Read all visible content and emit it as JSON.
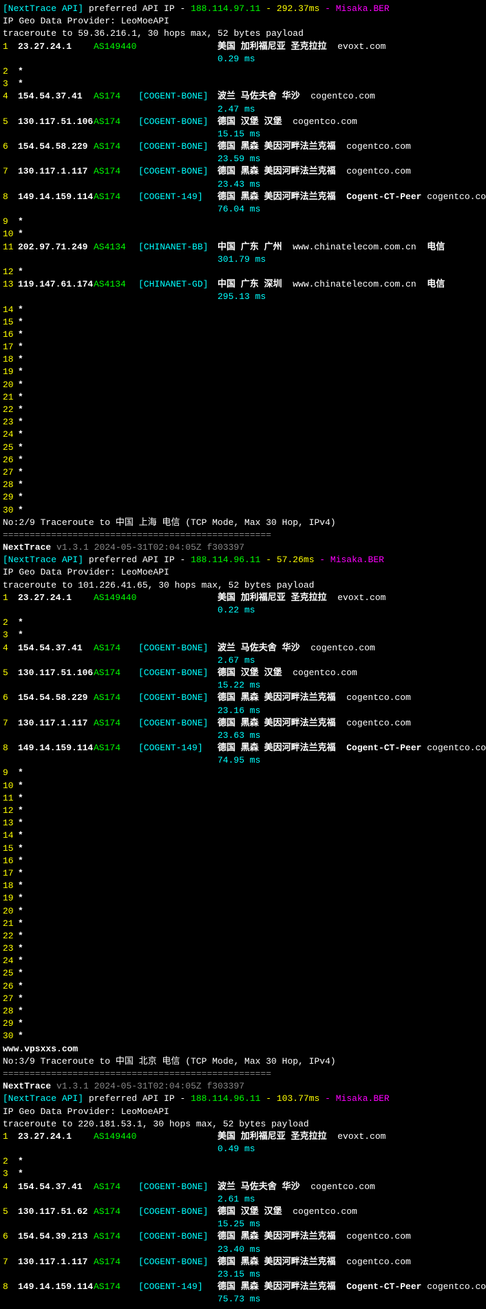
{
  "section1": {
    "api_line_prefix": "[NextTrace API]",
    "api_line_text": " preferred API IP - ",
    "api_ip": "188.114.97.11",
    "api_latency": " - 292.37ms",
    "api_server": " - Misaka.BER",
    "provider": "IP Geo Data Provider: LeoMoeAPI",
    "trace_header": "traceroute to 59.36.216.1, 30 hops max, 52 bytes payload",
    "hops": [
      {
        "n": "1",
        "ip": "23.27.24.1",
        "asn": "AS149440",
        "net": "",
        "geo": "美国 加利福尼亚 圣克拉拉",
        "dom": "evoxt.com",
        "peer": "",
        "lat": "0.29 ms"
      },
      {
        "n": "2",
        "star": true
      },
      {
        "n": "3",
        "star": true
      },
      {
        "n": "4",
        "ip": "154.54.37.41",
        "asn": "AS174",
        "net": "[COGENT-BONE]",
        "geo": "波兰 马佐夫舍 华沙",
        "dom": "cogentco.com",
        "peer": "",
        "lat": "2.47 ms"
      },
      {
        "n": "5",
        "ip": "130.117.51.106",
        "asn": "AS174",
        "net": "[COGENT-BONE]",
        "geo": "德国 汉堡 汉堡",
        "dom": "cogentco.com",
        "peer": "",
        "lat": "15.15 ms"
      },
      {
        "n": "6",
        "ip": "154.54.58.229",
        "asn": "AS174",
        "net": "[COGENT-BONE]",
        "geo": "德国 黑森 美因河畔法兰克福",
        "dom": "cogentco.com",
        "peer": "",
        "lat": "23.59 ms"
      },
      {
        "n": "7",
        "ip": "130.117.1.117",
        "asn": "AS174",
        "net": "[COGENT-BONE]",
        "geo": "德国 黑森 美因河畔法兰克福",
        "dom": "cogentco.com",
        "peer": "",
        "lat": "23.43 ms"
      },
      {
        "n": "8",
        "ip": "149.14.159.114",
        "asn": "AS174",
        "net": "[COGENT-149]",
        "geo": "德国 黑森 美因河畔法兰克福",
        "peer": "Cogent-CT-Peer",
        "dom": "cogentco.com",
        "lat": "76.04 ms"
      },
      {
        "n": "9",
        "star": true
      },
      {
        "n": "10",
        "star": true
      },
      {
        "n": "11",
        "ip": "202.97.71.249",
        "asn": "AS4134",
        "net": "[CHINANET-BB]",
        "geo": "中国 广东 广州",
        "dom": "www.chinatelecom.com.cn",
        "peer": "电信",
        "lat": "301.79 ms"
      },
      {
        "n": "12",
        "star": true
      },
      {
        "n": "13",
        "ip": "119.147.61.174",
        "asn": "AS4134",
        "net": "[CHINANET-GD]",
        "geo": "中国 广东 深圳",
        "dom": "www.chinatelecom.com.cn",
        "peer": "电信",
        "lat": "295.13 ms"
      },
      {
        "n": "14",
        "star": true
      },
      {
        "n": "15",
        "star": true
      },
      {
        "n": "16",
        "star": true
      },
      {
        "n": "17",
        "star": true
      },
      {
        "n": "18",
        "star": true
      },
      {
        "n": "19",
        "star": true
      },
      {
        "n": "20",
        "star": true
      },
      {
        "n": "21",
        "star": true
      },
      {
        "n": "22",
        "star": true
      },
      {
        "n": "23",
        "star": true
      },
      {
        "n": "24",
        "star": true
      },
      {
        "n": "25",
        "star": true
      },
      {
        "n": "26",
        "star": true
      },
      {
        "n": "27",
        "star": true
      },
      {
        "n": "28",
        "star": true
      },
      {
        "n": "29",
        "star": true
      },
      {
        "n": "30",
        "star": true
      }
    ]
  },
  "section2": {
    "title": "No:2/9 Traceroute to 中国 上海 电信 (TCP Mode, Max 30 Hop, IPv4)",
    "divider": "==================================================",
    "version": "NextTrace v1.3.1 2024-05-31T02:04:05Z f303397",
    "api_line_prefix": "[NextTrace API]",
    "api_line_text": " preferred API IP - ",
    "api_ip": "188.114.96.11",
    "api_latency": " - 57.26ms",
    "api_server": " - Misaka.BER",
    "provider": "IP Geo Data Provider: LeoMoeAPI",
    "trace_header": "traceroute to 101.226.41.65, 30 hops max, 52 bytes payload",
    "hops": [
      {
        "n": "1",
        "ip": "23.27.24.1",
        "asn": "AS149440",
        "net": "",
        "geo": "美国 加利福尼亚 圣克拉拉",
        "dom": "evoxt.com",
        "peer": "",
        "lat": "0.22 ms"
      },
      {
        "n": "2",
        "star": true
      },
      {
        "n": "3",
        "star": true
      },
      {
        "n": "4",
        "ip": "154.54.37.41",
        "asn": "AS174",
        "net": "[COGENT-BONE]",
        "geo": "波兰 马佐夫舍 华沙",
        "dom": "cogentco.com",
        "peer": "",
        "lat": "2.67 ms"
      },
      {
        "n": "5",
        "ip": "130.117.51.106",
        "asn": "AS174",
        "net": "[COGENT-BONE]",
        "geo": "德国 汉堡 汉堡",
        "dom": "cogentco.com",
        "peer": "",
        "lat": "15.22 ms"
      },
      {
        "n": "6",
        "ip": "154.54.58.229",
        "asn": "AS174",
        "net": "[COGENT-BONE]",
        "geo": "德国 黑森 美因河畔法兰克福",
        "dom": "cogentco.com",
        "peer": "",
        "lat": "23.16 ms"
      },
      {
        "n": "7",
        "ip": "130.117.1.117",
        "asn": "AS174",
        "net": "[COGENT-BONE]",
        "geo": "德国 黑森 美因河畔法兰克福",
        "dom": "cogentco.com",
        "peer": "",
        "lat": "23.63 ms"
      },
      {
        "n": "8",
        "ip": "149.14.159.114",
        "asn": "AS174",
        "net": "[COGENT-149]",
        "geo": "德国 黑森 美因河畔法兰克福",
        "peer": "Cogent-CT-Peer",
        "dom": "cogentco.com",
        "lat": "74.95 ms"
      },
      {
        "n": "9",
        "star": true
      },
      {
        "n": "10",
        "star": true
      },
      {
        "n": "11",
        "star": true
      },
      {
        "n": "12",
        "star": true
      },
      {
        "n": "13",
        "star": true
      },
      {
        "n": "14",
        "star": true
      },
      {
        "n": "15",
        "star": true
      },
      {
        "n": "16",
        "star": true
      },
      {
        "n": "17",
        "star": true
      },
      {
        "n": "18",
        "star": true
      },
      {
        "n": "19",
        "star": true
      },
      {
        "n": "20",
        "star": true
      },
      {
        "n": "21",
        "star": true
      },
      {
        "n": "22",
        "star": true
      },
      {
        "n": "23",
        "star": true
      },
      {
        "n": "24",
        "star": true
      },
      {
        "n": "25",
        "star": true
      },
      {
        "n": "26",
        "star": true
      },
      {
        "n": "27",
        "star": true
      },
      {
        "n": "28",
        "star": true
      },
      {
        "n": "29",
        "star": true
      },
      {
        "n": "30",
        "star": true
      }
    ]
  },
  "watermark": "www.vpsxxs.com",
  "section3": {
    "title": "No:3/9 Traceroute to 中国 北京 电信 (TCP Mode, Max 30 Hop, IPv4)",
    "divider": "==================================================",
    "version": "NextTrace v1.3.1 2024-05-31T02:04:05Z f303397",
    "api_line_prefix": "[NextTrace API]",
    "api_line_text": " preferred API IP - ",
    "api_ip": "188.114.96.11",
    "api_latency": " - 103.77ms",
    "api_server": " - Misaka.BER",
    "provider": "IP Geo Data Provider: LeoMoeAPI",
    "trace_header": "traceroute to 220.181.53.1, 30 hops max, 52 bytes payload",
    "hops": [
      {
        "n": "1",
        "ip": "23.27.24.1",
        "asn": "AS149440",
        "net": "",
        "geo": "美国 加利福尼亚 圣克拉拉",
        "dom": "evoxt.com",
        "peer": "",
        "lat": "0.49 ms"
      },
      {
        "n": "2",
        "star": true
      },
      {
        "n": "3",
        "star": true
      },
      {
        "n": "4",
        "ip": "154.54.37.41",
        "asn": "AS174",
        "net": "[COGENT-BONE]",
        "geo": "波兰 马佐夫舍 华沙",
        "dom": "cogentco.com",
        "peer": "",
        "lat": "2.61 ms"
      },
      {
        "n": "5",
        "ip": "130.117.51.62",
        "asn": "AS174",
        "net": "[COGENT-BONE]",
        "geo": "德国 汉堡 汉堡",
        "dom": "cogentco.com",
        "peer": "",
        "lat": "15.25 ms"
      },
      {
        "n": "6",
        "ip": "154.54.39.213",
        "asn": "AS174",
        "net": "[COGENT-BONE]",
        "geo": "德国 黑森 美因河畔法兰克福",
        "dom": "cogentco.com",
        "peer": "",
        "lat": "23.40 ms"
      },
      {
        "n": "7",
        "ip": "130.117.1.117",
        "asn": "AS174",
        "net": "[COGENT-BONE]",
        "geo": "德国 黑森 美因河畔法兰克福",
        "dom": "cogentco.com",
        "peer": "",
        "lat": "23.15 ms"
      },
      {
        "n": "8",
        "ip": "149.14.159.114",
        "asn": "AS174",
        "net": "[COGENT-149]",
        "geo": "德国 黑森 美因河畔法兰克福",
        "peer": "Cogent-CT-Peer",
        "dom": "cogentco.com",
        "lat": "75.73 ms"
      }
    ]
  }
}
